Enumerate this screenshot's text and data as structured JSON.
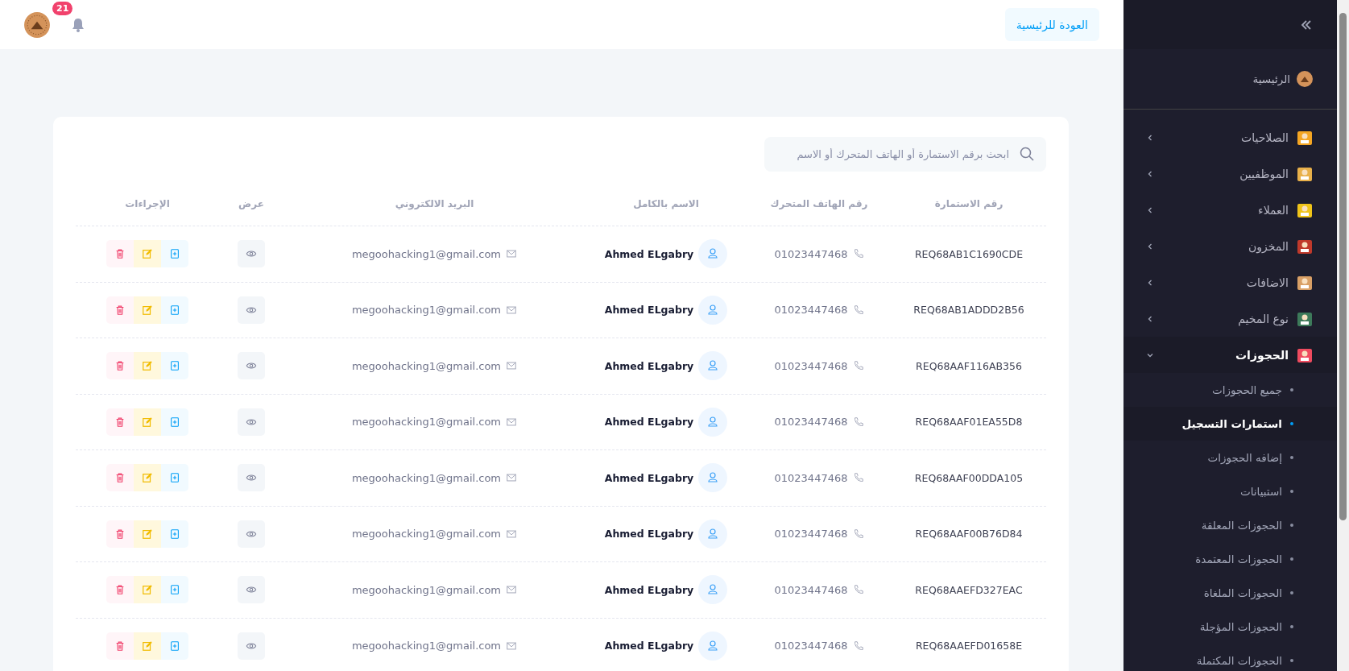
{
  "topbar": {
    "notification_count": "21",
    "back_button": "العودة للرئيسية"
  },
  "sidebar": {
    "home": "الرئيسية",
    "items": [
      {
        "label": "الصلاحيات",
        "expanded": false
      },
      {
        "label": "الموظفيين",
        "expanded": false
      },
      {
        "label": "العملاء",
        "expanded": false
      },
      {
        "label": "المخزون",
        "expanded": false
      },
      {
        "label": "الاضافات",
        "expanded": false
      },
      {
        "label": "نوع المخيم",
        "expanded": false
      },
      {
        "label": "الحجوزات",
        "expanded": true,
        "children": [
          {
            "label": "جميع الحجوزات",
            "selected": false
          },
          {
            "label": "استمارات التسجيل",
            "selected": true
          },
          {
            "label": "إضافه الحجوزات",
            "selected": false
          },
          {
            "label": "استبيانات",
            "selected": false
          },
          {
            "label": "الحجوزات المعلقة",
            "selected": false
          },
          {
            "label": "الحجوزات المعتمدة",
            "selected": false
          },
          {
            "label": "الحجوزات الملغاة",
            "selected": false
          },
          {
            "label": "الحجوزات المؤجلة",
            "selected": false
          },
          {
            "label": "الحجوزات المكتملة",
            "selected": false
          }
        ]
      }
    ]
  },
  "search": {
    "placeholder": "ابحث برقم الاستمارة أو الهاتف المتحرك أو الاسم"
  },
  "table": {
    "columns": [
      "رقم الاستمارة",
      "رقم الهاتف المتحرك",
      "الاسم بالكامل",
      "البريد الالكتروني",
      "عرض",
      "الإجراءات"
    ],
    "rows": [
      {
        "id": "REQ68AB1C1690CDE",
        "phone": "01023447468",
        "name": "Ahmed ELgabry",
        "email": "megoohacking1@gmail.com"
      },
      {
        "id": "REQ68AB1ADDD2B56",
        "phone": "01023447468",
        "name": "Ahmed ELgabry",
        "email": "megoohacking1@gmail.com"
      },
      {
        "id": "REQ68AAF116AB356",
        "phone": "01023447468",
        "name": "Ahmed ELgabry",
        "email": "megoohacking1@gmail.com"
      },
      {
        "id": "REQ68AAF01EA55D8",
        "phone": "01023447468",
        "name": "Ahmed ELgabry",
        "email": "megoohacking1@gmail.com"
      },
      {
        "id": "REQ68AAF00DDA105",
        "phone": "01023447468",
        "name": "Ahmed ELgabry",
        "email": "megoohacking1@gmail.com"
      },
      {
        "id": "REQ68AAF00B76D84",
        "phone": "01023447468",
        "name": "Ahmed ELgabry",
        "email": "megoohacking1@gmail.com"
      },
      {
        "id": "REQ68AAEFD327EAC",
        "phone": "01023447468",
        "name": "Ahmed ELgabry",
        "email": "megoohacking1@gmail.com"
      },
      {
        "id": "REQ68AAEFD01658E",
        "phone": "01023447468",
        "name": "Ahmed ELgabry",
        "email": "megoohacking1@gmail.com"
      }
    ]
  }
}
